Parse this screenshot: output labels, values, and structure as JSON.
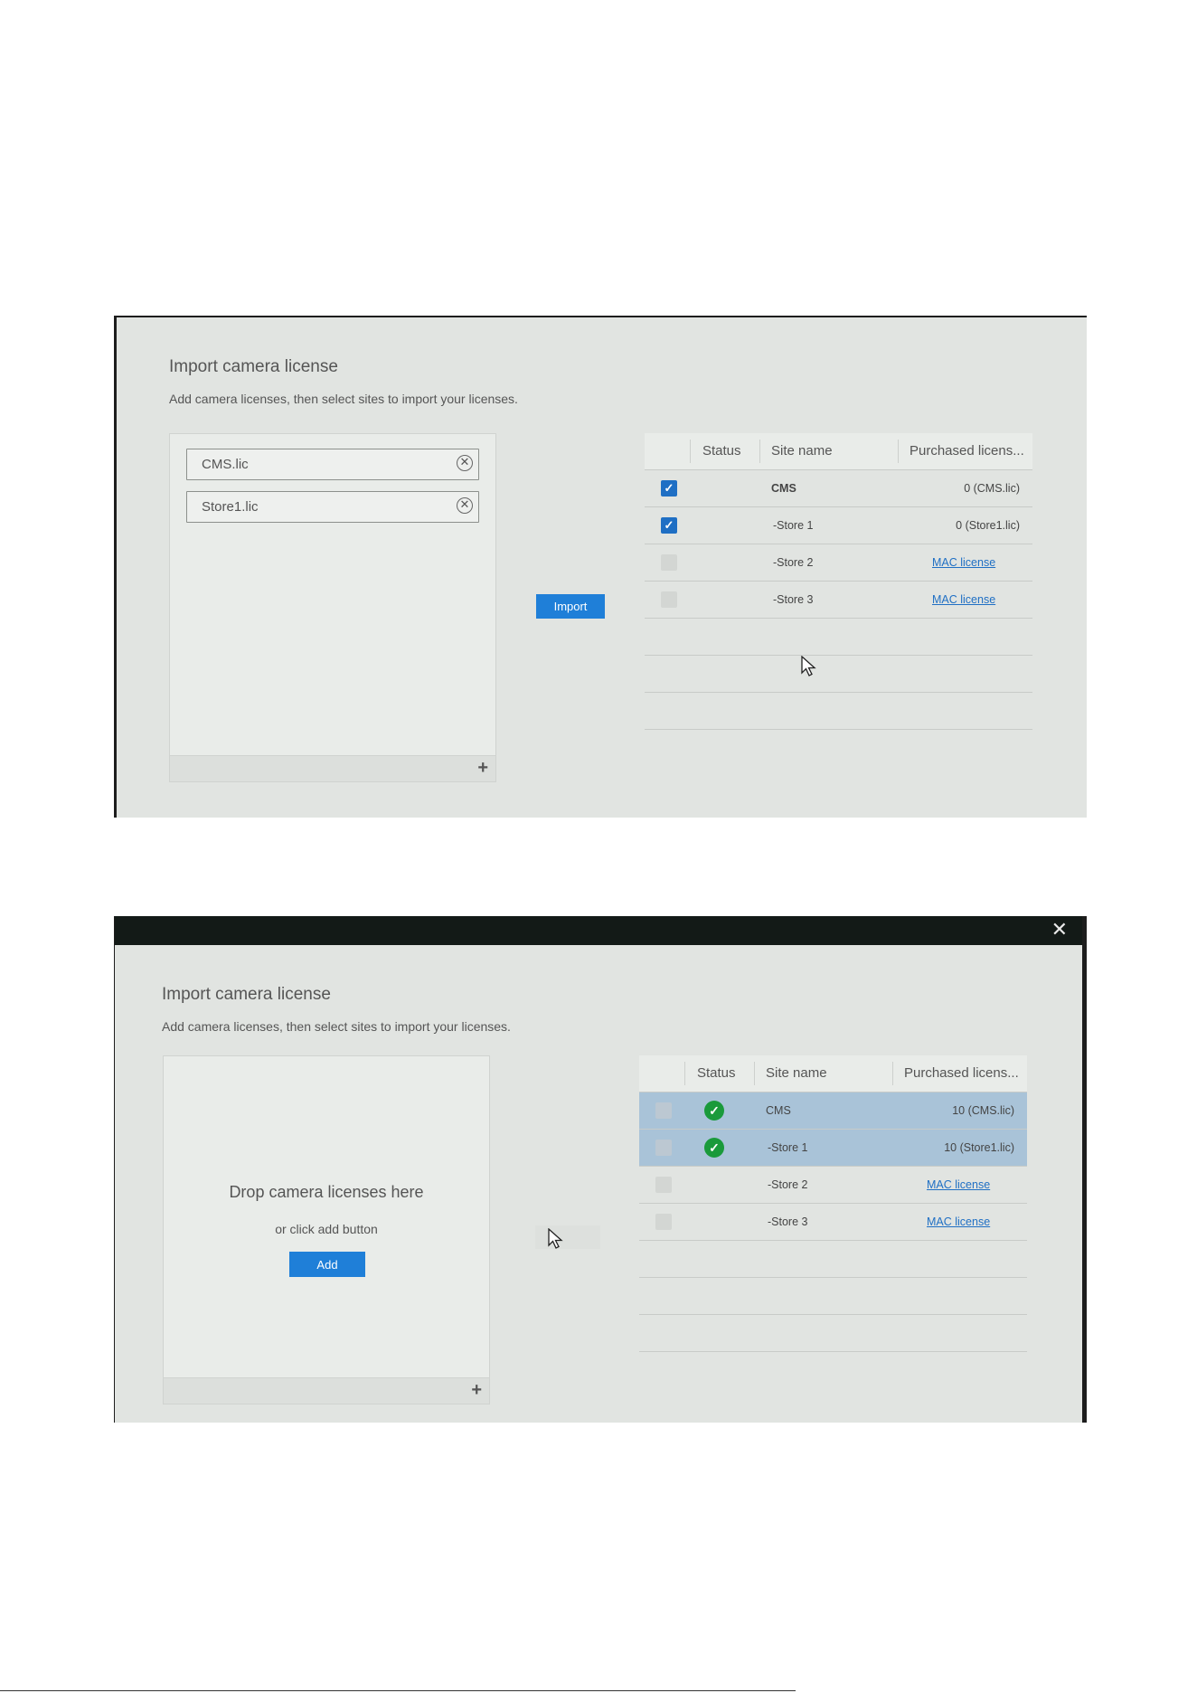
{
  "dialog": {
    "title": "Import camera license",
    "subtitle": "Add camera licenses, then select sites to import your licenses."
  },
  "table_headers": {
    "status": "Status",
    "site_name": "Site name",
    "purchased": "Purchased licens..."
  },
  "screen1": {
    "files": [
      {
        "name": "CMS.lic"
      },
      {
        "name": "Store1.lic"
      }
    ],
    "import_label": "Import",
    "rows": [
      {
        "checked": true,
        "site": "CMS",
        "purchased": "0 (CMS.lic)"
      },
      {
        "checked": true,
        "site": "-Store 1",
        "purchased": "0 (Store1.lic)"
      },
      {
        "checked": false,
        "site": "-Store 2",
        "link": "MAC license"
      },
      {
        "checked": false,
        "site": "-Store 3",
        "link": "MAC license"
      }
    ]
  },
  "screen2": {
    "drop_title": "Drop camera licenses here",
    "drop_sub": "or click add button",
    "add_label": "Add",
    "close_glyph": "✕",
    "rows": [
      {
        "selected": true,
        "status": "ok",
        "site": "CMS",
        "purchased": "10 (CMS.lic)"
      },
      {
        "selected": true,
        "status": "ok",
        "site": "-Store 1",
        "purchased": "10 (Store1.lic)"
      },
      {
        "selected": false,
        "site": "-Store 2",
        "link": "MAC license"
      },
      {
        "selected": false,
        "site": "-Store 3",
        "link": "MAC license"
      }
    ]
  },
  "icons": {
    "plus": "plus-icon",
    "remove": "close-circle-icon",
    "check": "check-icon",
    "status_ok": "check-circle-icon",
    "cursor": "mouse-pointer-icon"
  },
  "colors": {
    "accent": "#1f7fd8",
    "checkbox_on": "#1f6fc4",
    "selected_row": "#a9c3d8",
    "status_ok": "#1a9a3b",
    "link": "#1f6fc4"
  }
}
